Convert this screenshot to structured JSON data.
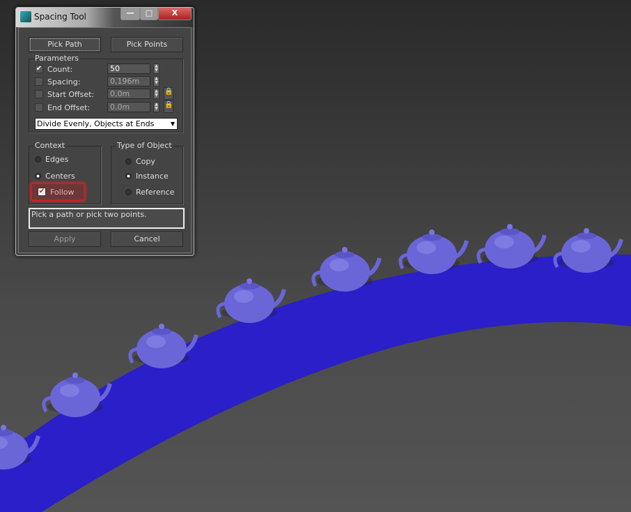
{
  "dialog": {
    "title": "Spacing Tool",
    "minimize": "—",
    "maximize": "□",
    "close": "X",
    "pick_path": "Pick Path",
    "pick_points": "Pick Points",
    "parameters": {
      "label": "Parameters",
      "count": {
        "label": "Count:",
        "checked": true,
        "value": "50"
      },
      "spacing": {
        "label": "Spacing:",
        "checked": false,
        "value": "0,196m"
      },
      "start_offset": {
        "label": "Start Offset:",
        "checked": false,
        "value": "0,0m"
      },
      "end_offset": {
        "label": "End Offset:",
        "checked": false,
        "value": "0,0m"
      },
      "mode": "Divide Evenly, Objects at Ends"
    },
    "context": {
      "label": "Context",
      "edges": "Edges",
      "centers": "Centers",
      "follow": "Follow",
      "selected": "Centers",
      "follow_checked": true
    },
    "type_of_object": {
      "label": "Type of Object",
      "copy": "Copy",
      "instance": "Instance",
      "reference": "Reference",
      "selected": "Instance"
    },
    "status": "Pick a path or pick two points.",
    "apply": "Apply",
    "cancel": "Cancel"
  },
  "colors": {
    "highlight": "#cc1f1f",
    "path": "#2a1fc8",
    "teapot": "#6a66d8"
  }
}
